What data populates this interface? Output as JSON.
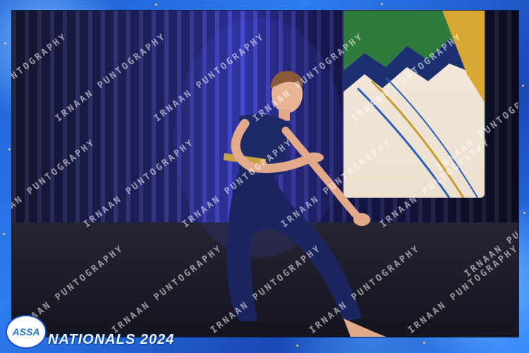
{
  "watermark_text": "IRNAAN PUNTOGRAPHY",
  "logo_text": "ASSA",
  "event_title": "NATIONALS 2024"
}
